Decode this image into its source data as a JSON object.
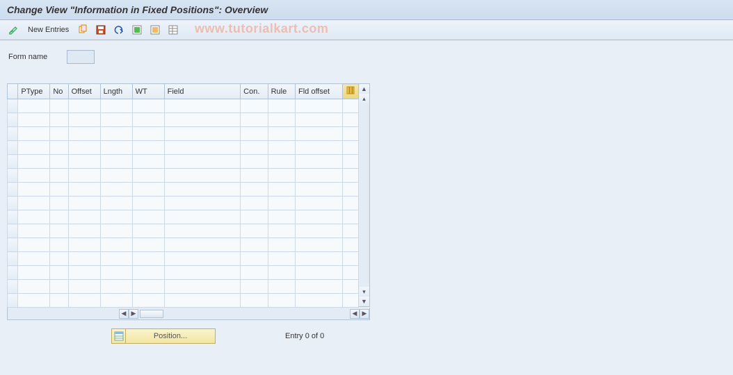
{
  "title": "Change View \"Information in Fixed Positions\": Overview",
  "toolbar": {
    "new_entries_label": "New Entries"
  },
  "form": {
    "form_name_label": "Form name",
    "form_name_value": ""
  },
  "table": {
    "columns": {
      "ptype": "PType",
      "no": "No",
      "offset": "Offset",
      "lngth": "Lngth",
      "wt": "WT",
      "field": "Field",
      "con": "Con.",
      "rule": "Rule",
      "fldoffset": "Fld offset"
    },
    "row_count": 15
  },
  "footer": {
    "position_label": "Position...",
    "entry_text": "Entry 0 of 0"
  },
  "watermark": "www.tutorialkart.com"
}
